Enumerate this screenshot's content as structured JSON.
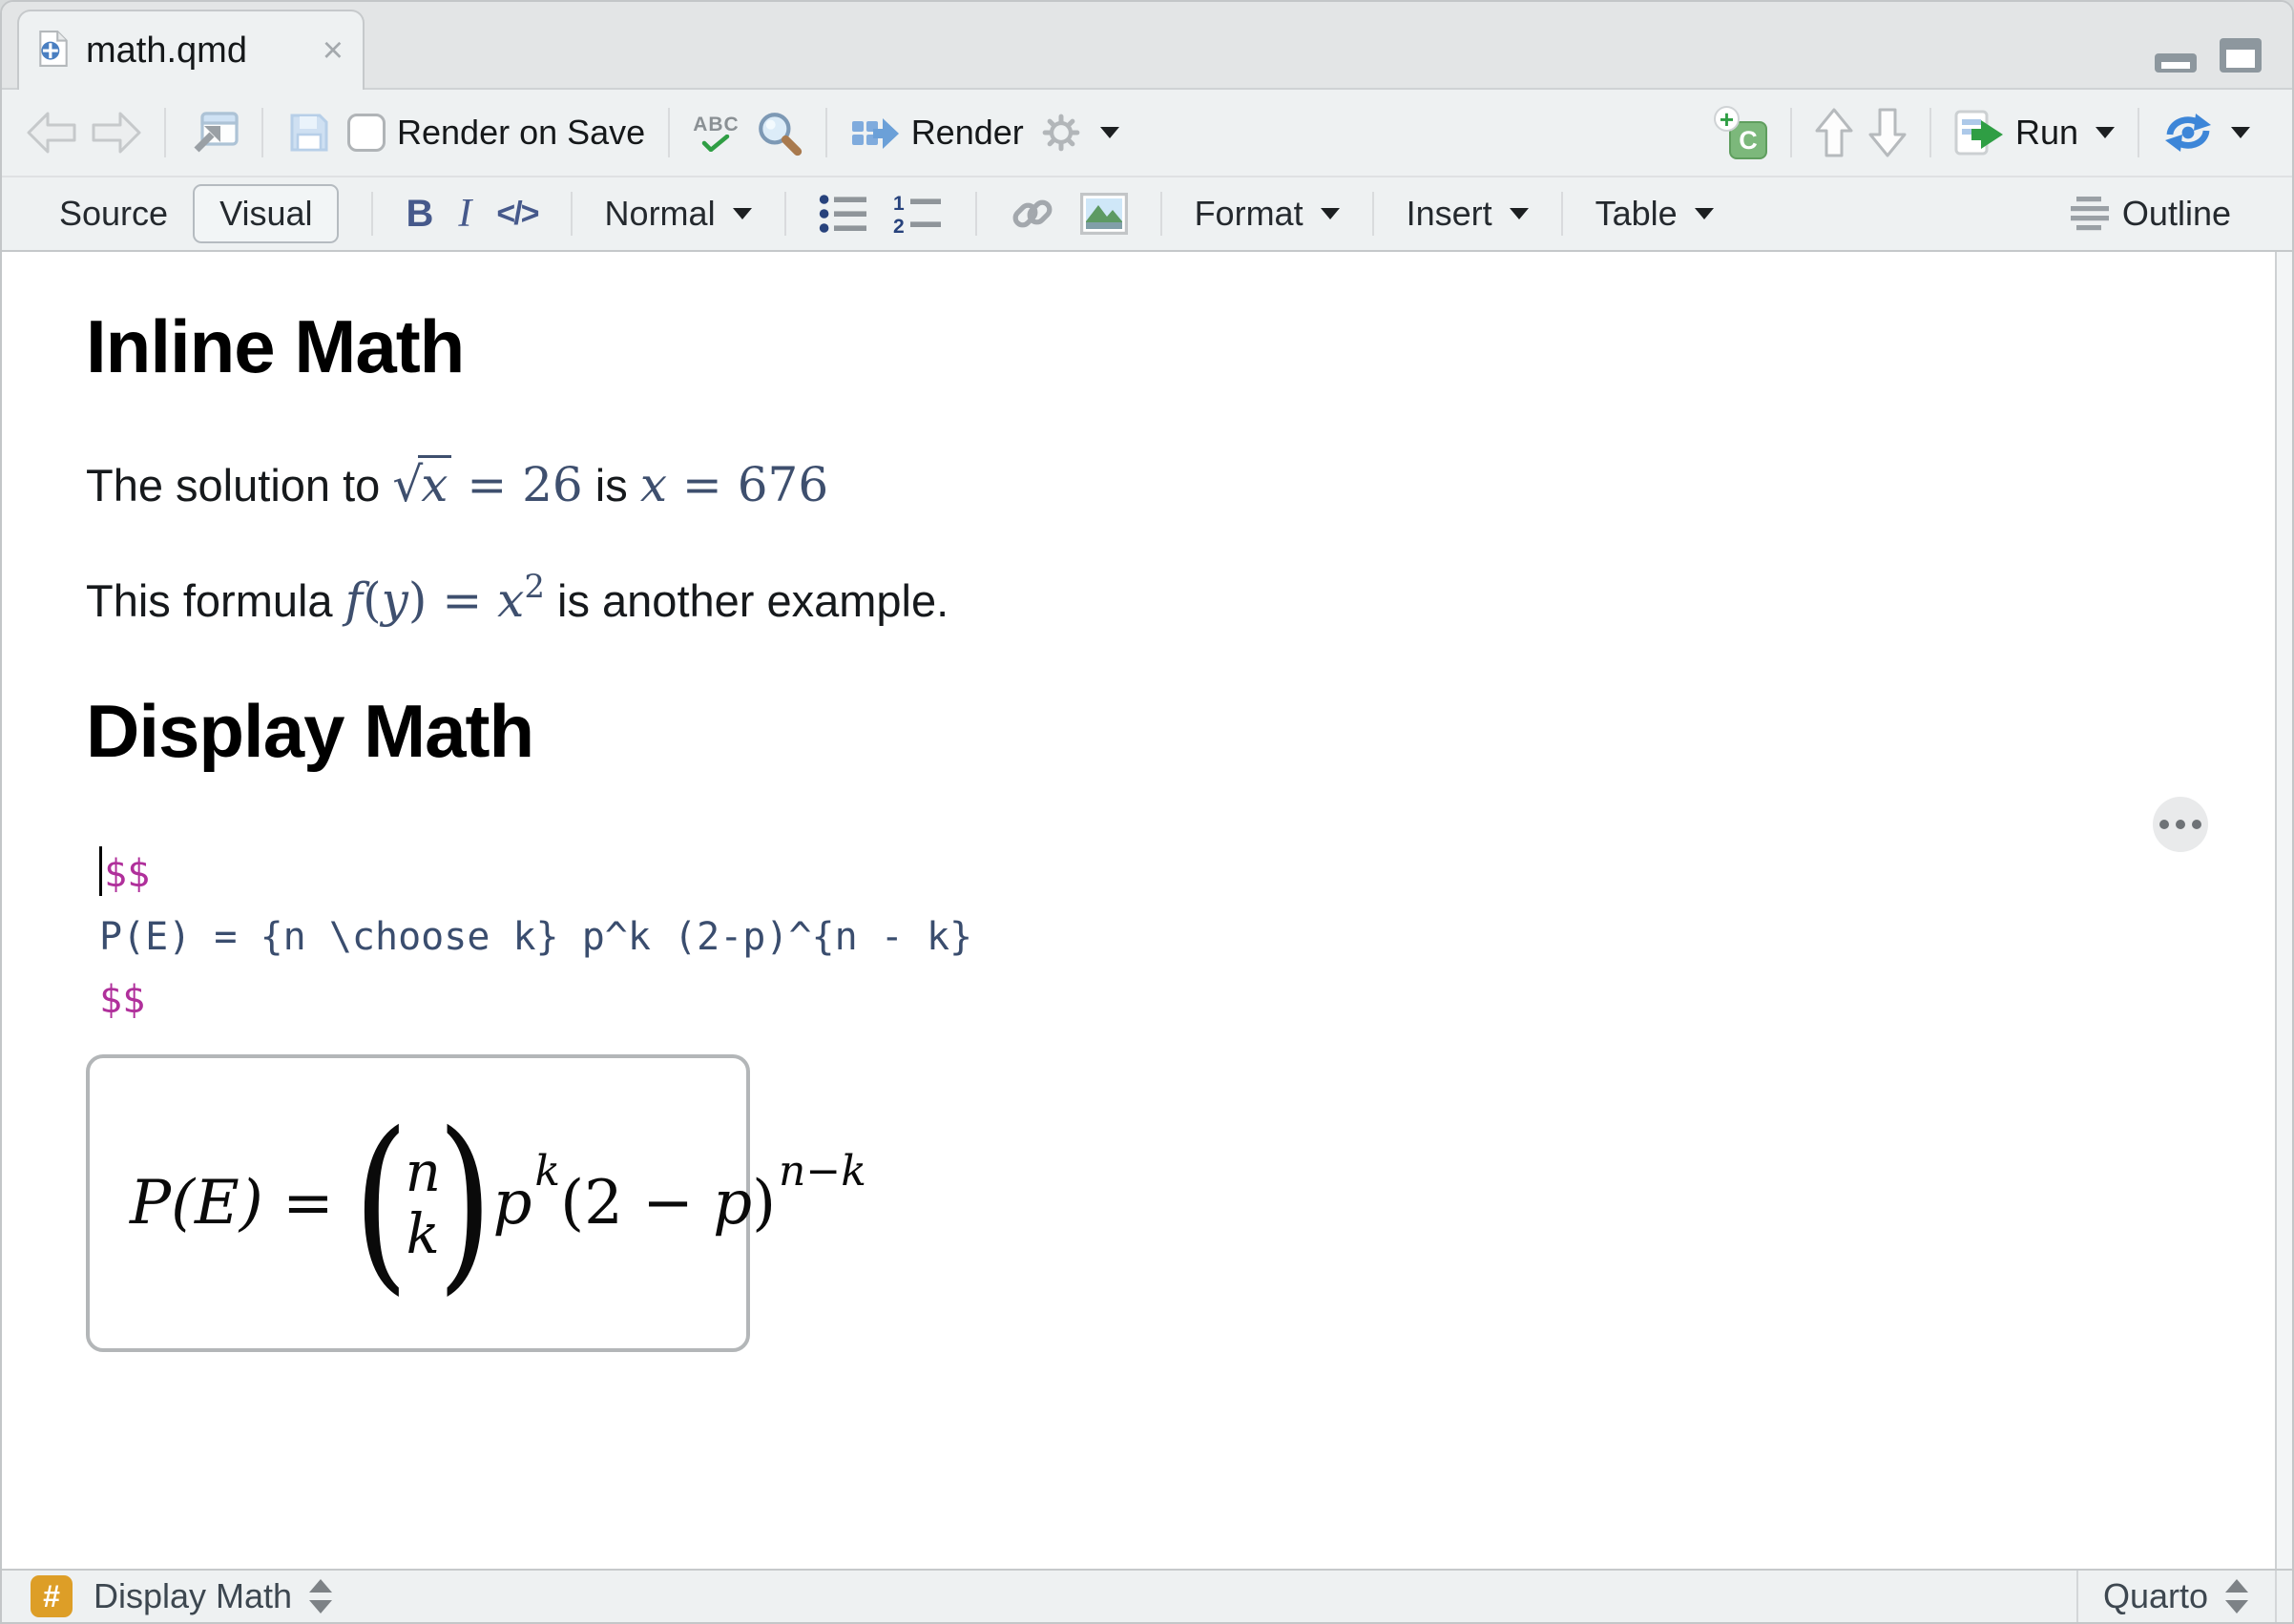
{
  "tab_bar": {
    "active_tab": {
      "title": "math.qmd",
      "close_glyph": "×"
    }
  },
  "toolbar": {
    "render_on_save_label": "Render on Save",
    "spellcheck_abc": "ABC",
    "render_label": "Render",
    "run_label": "Run"
  },
  "format_bar": {
    "source_label": "Source",
    "visual_label": "Visual",
    "bold_glyph": "B",
    "italic_glyph": "I",
    "code_glyph": "</>",
    "paragraph_style_label": "Normal",
    "format_menu_label": "Format",
    "insert_menu_label": "Insert",
    "table_menu_label": "Table",
    "outline_label": "Outline"
  },
  "editor": {
    "heading_inline_math": "Inline Math",
    "paragraph_1": {
      "text_before": "The solution to ",
      "radical_glyph": "√",
      "radicand": "x",
      "after_radical": " = 26",
      "text_middle": " is ",
      "x_var": "x",
      "x_value": " = 676"
    },
    "paragraph_2": {
      "text_before": "This formula ",
      "func": "f",
      "open_paren": "(",
      "arg": "y",
      "close_paren": ")",
      "equals": " = ",
      "base": "x",
      "exponent": "2",
      "text_after": " is another example."
    },
    "heading_display_math": "Display Math",
    "math_source": {
      "open_delimiter": "$$",
      "expression": "P(E) = {n \\choose k} p^k (2-p)^{n - k}",
      "close_delimiter": "$$"
    },
    "math_preview": {
      "lhs": "P(E)",
      "equals": " = ",
      "open_big_paren": "(",
      "binom_top": "n",
      "binom_bottom": "k",
      "close_big_paren": ")",
      "p_base": "p",
      "p_exp": "k",
      "group_open": "(2 − ",
      "group_p": "p",
      "group_close": ")",
      "group_exp": "n−k"
    }
  },
  "status_bar": {
    "block_label": "Display Math",
    "format_label": "Quarto"
  },
  "colors": {
    "accent_blue": "#4a7fc1",
    "math_blue": "#3e4f6e",
    "delimiter_magenta": "#b0309b",
    "heading_badge_orange": "#dd9e27",
    "run_green": "#2f9e44",
    "toolbar_bg": "#eef1f2"
  }
}
